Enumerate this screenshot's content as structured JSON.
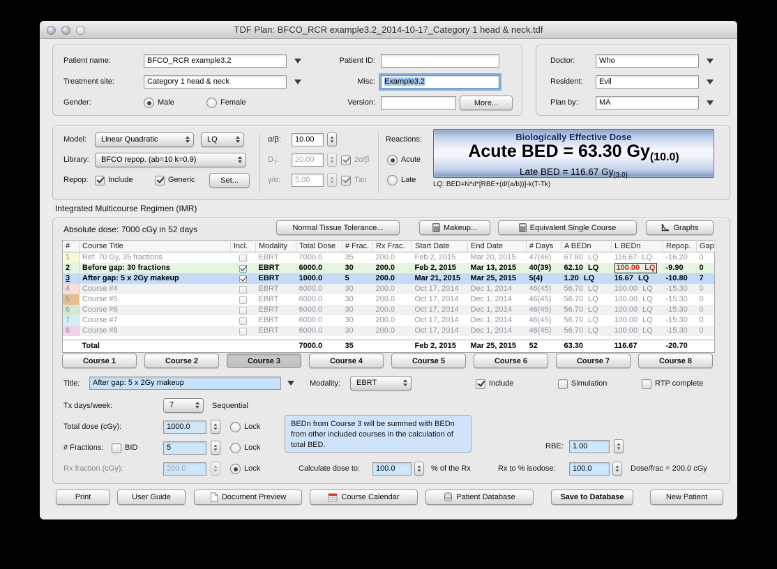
{
  "window": {
    "title": "TDF Plan: BFCO_RCR example3.2_2014-10-17_Category 1 head & neck.tdf"
  },
  "patient": {
    "name_label": "Patient name:",
    "name": "BFCO_RCR example3.2",
    "site_label": "Treatment site:",
    "site": "Category 1 head & neck",
    "gender_label": "Gender:",
    "male": "Male",
    "female": "Female",
    "id_label": "Patient ID:",
    "id": "",
    "misc_label": "Misc:",
    "misc": "Example3.2",
    "version_label": "Version:",
    "version": "",
    "more_button": "More..."
  },
  "staff": {
    "doctor_label": "Doctor:",
    "doctor": "Who",
    "resident_label": "Resident:",
    "resident": "Evil",
    "planby_label": "Plan by:",
    "planby": "MA"
  },
  "model": {
    "model_label": "Model:",
    "model_value": "Linear Quadratic",
    "model_short": "LQ",
    "library_label": "Library:",
    "library_value": "BFCO repop. (ab=10 k=0.9)",
    "repop_label": "Repop:",
    "include": "Include",
    "generic": "Generic",
    "set_button": "Set...",
    "ab_label": "α/β:",
    "ab_value": "10.00",
    "dt_label": "D",
    "dt_sub": "T",
    "dt_suffix": ":",
    "dt_value": "20.00",
    "two_ab": "2α/β",
    "ga_label": "γ/α:",
    "ga_value": "5.00",
    "tan": "Tan",
    "reactions_label": "Reactions:",
    "acute": "Acute",
    "late": "Late"
  },
  "bed": {
    "title": "Biologically Effective Dose",
    "acute_main": "Acute BED = 63.30 Gy",
    "acute_sub": "(10.0)",
    "late_main": "Late BED = 116.67 Gy",
    "late_sub": "(3.0)",
    "formula": "LQ: BED=N*d*[RBE+(d/(a/b))]-k(T-Tk)"
  },
  "imr": {
    "section_title": "Integrated Multicourse Regimen (IMR)",
    "absolute_dose": "Absolute dose: 7000 cGy in 52 days",
    "toolbar": [
      {
        "label": "Normal Tissue Tolerance...",
        "icon": null,
        "name": "normal-tissue-tolerance-button"
      },
      {
        "label": "Makeup...",
        "icon": "calculator",
        "name": "makeup-button"
      },
      {
        "label": "Equivalent Single Course",
        "icon": "calculator",
        "name": "equivalent-single-course-button"
      },
      {
        "label": "Graphs",
        "icon": "graph",
        "name": "graphs-button"
      }
    ],
    "table": {
      "headers": [
        "#",
        "Course Title",
        "Incl.",
        "Modality",
        "Total Dose",
        "# Frac.",
        "Rx Frac.",
        "Start Date",
        "End Date",
        "# Days",
        "A BEDn",
        "L BEDn",
        "Repop.",
        "Gap"
      ],
      "rows": [
        {
          "num": "1",
          "title": "Ref. 70 Gy, 35 fractions",
          "incl": false,
          "modality": "EBRT",
          "total_dose": "7000.0",
          "n_frac": "35",
          "rx_frac": "200.0",
          "start": "Feb 2, 2015",
          "end": "Mar 20, 2015",
          "days": "47(46)",
          "a_bed": "67.80",
          "a_model": "LQ",
          "l_bed": "116.67",
          "l_model": "LQ",
          "l_bed_alert": false,
          "repop": "-16.20",
          "gap": "0",
          "num_color": "#faf7d6",
          "row_color": "",
          "state": "dim",
          "zebra": "white"
        },
        {
          "num": "2",
          "title": "Before gap: 30 fractions",
          "incl": true,
          "modality": "EBRT",
          "total_dose": "6000.0",
          "n_frac": "30",
          "rx_frac": "200.0",
          "start": "Feb 2, 2015",
          "end": "Mar 13, 2015",
          "days": "40(39)",
          "a_bed": "62.10",
          "a_model": "LQ",
          "l_bed": "100.00",
          "l_model": "LQ",
          "l_bed_alert": true,
          "repop": "-9.90",
          "gap": "0",
          "num_color": "#d4efcc",
          "row_color": "#e4f6e0",
          "state": "on",
          "zebra": "white"
        },
        {
          "num": "3",
          "title": "After gap: 5 x 2Gy makeup",
          "incl": true,
          "modality": "EBRT",
          "total_dose": "1000.0",
          "n_frac": "5",
          "rx_frac": "200.0",
          "start": "Mar 21, 2015",
          "end": "Mar 25, 2015",
          "days": "5(4)",
          "a_bed": "1.20",
          "a_model": "LQ",
          "l_bed": "16.67",
          "l_model": "LQ",
          "l_bed_alert": false,
          "repop": "-10.80",
          "gap": "7",
          "num_color": "#c5dcf8",
          "row_color": "#c5dcf8",
          "state": "selected",
          "zebra": "white"
        },
        {
          "num": "4",
          "title": "Course #4",
          "incl": false,
          "modality": "EBRT",
          "total_dose": "6000.0",
          "n_frac": "30",
          "rx_frac": "200.0",
          "start": "Oct 17, 2014",
          "end": "Dec 1, 2014",
          "days": "46(45)",
          "a_bed": "56.70",
          "a_model": "LQ",
          "l_bed": "100.00",
          "l_model": "LQ",
          "l_bed_alert": false,
          "repop": "-15.30",
          "gap": "0",
          "num_color": "#f8dbdb",
          "row_color": "",
          "state": "dim",
          "zebra": "gray"
        },
        {
          "num": "5",
          "title": "Course #5",
          "incl": false,
          "modality": "EBRT",
          "total_dose": "6000.0",
          "n_frac": "30",
          "rx_frac": "200.0",
          "start": "Oct 17, 2014",
          "end": "Dec 1, 2014",
          "days": "46(45)",
          "a_bed": "56.70",
          "a_model": "LQ",
          "l_bed": "100.00",
          "l_model": "LQ",
          "l_bed_alert": false,
          "repop": "-15.30",
          "gap": "0",
          "num_color": "#e5bd90",
          "row_color": "",
          "state": "dim",
          "zebra": "white"
        },
        {
          "num": "6",
          "title": "Course #6",
          "incl": false,
          "modality": "EBRT",
          "total_dose": "6000.0",
          "n_frac": "30",
          "rx_frac": "200.0",
          "start": "Oct 17, 2014",
          "end": "Dec 1, 2014",
          "days": "46(45)",
          "a_bed": "56.70",
          "a_model": "LQ",
          "l_bed": "100.00",
          "l_model": "LQ",
          "l_bed_alert": false,
          "repop": "-15.30",
          "gap": "0",
          "num_color": "#d3e9cd",
          "row_color": "",
          "state": "dim",
          "zebra": "gray"
        },
        {
          "num": "7",
          "title": "Course #7",
          "incl": false,
          "modality": "EBRT",
          "total_dose": "6000.0",
          "n_frac": "30",
          "rx_frac": "200.0",
          "start": "Oct 17, 2014",
          "end": "Dec 1, 2014",
          "days": "46(45)",
          "a_bed": "56.70",
          "a_model": "LQ",
          "l_bed": "100.00",
          "l_model": "LQ",
          "l_bed_alert": false,
          "repop": "-15.30",
          "gap": "0",
          "num_color": "#d2f1f0",
          "row_color": "",
          "state": "dim",
          "zebra": "white"
        },
        {
          "num": "8",
          "title": "Course #8",
          "incl": false,
          "modality": "EBRT",
          "total_dose": "6000.0",
          "n_frac": "30",
          "rx_frac": "200.0",
          "start": "Oct 17, 2014",
          "end": "Dec 1, 2014",
          "days": "46(45)",
          "a_bed": "56.70",
          "a_model": "LQ",
          "l_bed": "100.00",
          "l_model": "LQ",
          "l_bed_alert": false,
          "repop": "-15.30",
          "gap": "0",
          "num_color": "#f0d2eb",
          "row_color": "",
          "state": "dim",
          "zebra": "gray"
        }
      ],
      "total": {
        "label": "Total",
        "total_dose": "7000.0",
        "n_frac": "35",
        "start": "Feb 2, 2015",
        "end": "Mar 25, 2015",
        "days": "52",
        "a_bed": "63.30",
        "l_bed": "116.67",
        "repop": "-20.70"
      }
    },
    "course_buttons": [
      "Course 1",
      "Course 2",
      "Course 3",
      "Course 4",
      "Course 5",
      "Course 6",
      "Course 7",
      "Course 8"
    ],
    "active_course_index": 2
  },
  "detail": {
    "title_label": "Title:",
    "title_value": "After gap: 5 x 2Gy makeup",
    "modality_label": "Modality:",
    "modality_value": "EBRT",
    "include": "Include",
    "simulation": "Simulation",
    "rtp": "RTP complete",
    "tx_label": "Tx days/week:",
    "tx_value": "7",
    "sequential": "Sequential",
    "total_dose_label": "Total dose (cGy):",
    "total_dose": "1000.0",
    "fractions_label": "# Fractions:",
    "bid": "BID",
    "fractions": "5",
    "rx_fraction_label": "Rx fraction (cGy):",
    "rx_fraction": "200.0",
    "lock": "Lock",
    "note": "BEDn from Course 3 will be summed with BEDn from other included courses in the calculation of total BED.",
    "rbe_label": "RBE:",
    "rbe": "1.00",
    "calc_label": "Calculate dose to:",
    "calc_value": "100.0",
    "pct_rx": "% of the Rx",
    "isodose_label": "Rx to % isodose:",
    "isodose": "100.0",
    "dose_frac": "Dose/frac = 200.0 cGy"
  },
  "footer": {
    "buttons": [
      {
        "label": "Print",
        "icon": null,
        "bold": false,
        "name": "print-button"
      },
      {
        "label": "User Guide",
        "icon": null,
        "bold": false,
        "name": "user-guide-button"
      },
      {
        "label": "Document Preview",
        "icon": "document",
        "bold": false,
        "name": "document-preview-button"
      },
      {
        "label": "Course Calendar",
        "icon": "calendar",
        "bold": false,
        "name": "course-calendar-button"
      },
      {
        "label": "Patient Database",
        "icon": "database",
        "bold": false,
        "name": "patient-database-button"
      },
      {
        "label": "Save to Database",
        "icon": null,
        "bold": true,
        "name": "save-to-database-button"
      },
      {
        "label": "New Patient",
        "icon": null,
        "bold": false,
        "name": "new-patient-button"
      }
    ]
  }
}
